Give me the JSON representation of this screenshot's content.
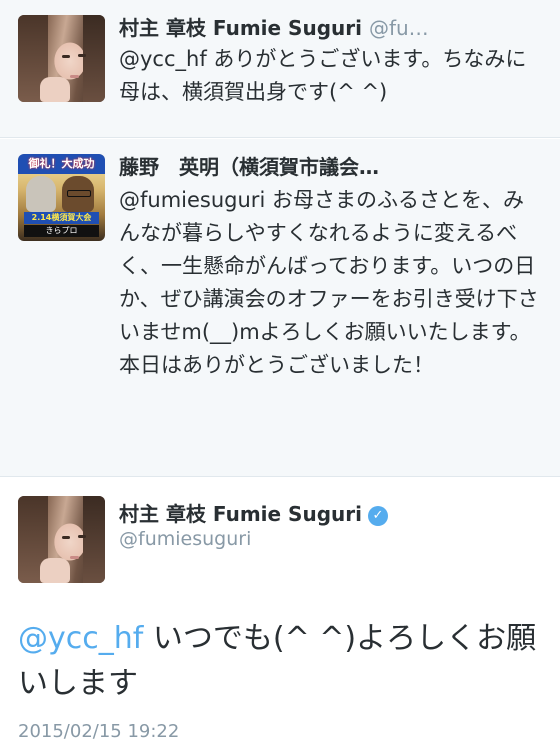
{
  "tweets": [
    {
      "author": "村主 章枝 Fumie Suguri",
      "handle_truncated": "@fu…",
      "mention": "@ycc_hf",
      "text": "ありがとうございます。ちなみに母は、横須賀出身です(^ ^)",
      "avatar": "woman-portrait"
    },
    {
      "author": "藤野　英明（横須賀市議会…",
      "mention": "@fumiesuguri",
      "text": "お母さまのふるさとを、みんなが暮らしやすくなれるように変えるべく、一生懸命がんばっております。いつの日か、ぜひ講演会のオファーをお引き受け下さいませm(__)mよろしくお願いいたします。本日はありがとうございました！",
      "avatar": "campaign-photo",
      "avatar_banner": "御礼！大成功",
      "avatar_caption": "2.14横須賀大会",
      "avatar_caption2": "きらプロ"
    }
  ],
  "main_tweet": {
    "author": "村主 章枝 Fumie Suguri",
    "verified_icon": "check-badge",
    "handle": "@fumiesuguri",
    "mention": "@ycc_hf",
    "text": "いつでも(^ ^)よろしくお願いします",
    "timestamp": "2015/02/15 19:22",
    "avatar": "woman-portrait"
  },
  "colors": {
    "link": "#55acee",
    "muted": "#8899a6",
    "reply_background": "#f5f8fa"
  }
}
